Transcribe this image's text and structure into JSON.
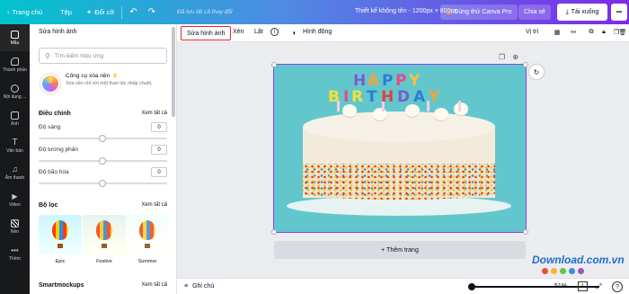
{
  "topbar": {
    "home": "Trang chủ",
    "file": "Tệp",
    "resize": "Đổi cỡ",
    "saved_note": "Đã lưu tất cả thay đổi",
    "design_title": "Thiết kế không tên - 1200px × 800px",
    "pro_button": "Dùng thử Canva Pro",
    "share_button": "Chia sẻ",
    "download_button": "Tải xuống",
    "more_button": "•••"
  },
  "rail": {
    "items": [
      {
        "label": "Mẫu",
        "icon": "template-icon"
      },
      {
        "label": "Thành phần",
        "icon": "elements-icon"
      },
      {
        "label": "Nội dung ...",
        "icon": "upload-icon"
      },
      {
        "label": "Ảnh",
        "icon": "photo-icon"
      },
      {
        "label": "Văn bản",
        "icon": "text-icon"
      },
      {
        "label": "Âm thanh",
        "icon": "audio-icon"
      },
      {
        "label": "Video",
        "icon": "video-icon"
      },
      {
        "label": "Nền",
        "icon": "background-icon"
      },
      {
        "label": "Thêm",
        "icon": "more-icon"
      }
    ]
  },
  "panel": {
    "title": "Sửa hình ảnh",
    "search_placeholder": "Tìm kiếm hiệu ứng",
    "bg_remover": {
      "name": "Công cụ xóa nền",
      "desc": "Xóa nền chỉ với một thao tác nhấp chuột."
    },
    "adjust": {
      "title": "Điều chỉnh",
      "see_all": "Xem tất cả",
      "sliders": [
        {
          "label": "Độ sáng",
          "value": "0"
        },
        {
          "label": "Độ tương phản",
          "value": "0"
        },
        {
          "label": "Độ bão hòa",
          "value": "0"
        }
      ]
    },
    "filters": {
      "title": "Bộ lọc",
      "see_all": "Xem tất cả",
      "items": [
        {
          "label": "Epic"
        },
        {
          "label": "Festive"
        },
        {
          "label": "Summer"
        }
      ]
    },
    "smartmockups": {
      "title": "Smartmockups",
      "see_all": "Xem tất cả"
    }
  },
  "context_toolbar": {
    "edit_image": "Sửa hình ảnh",
    "crop": "Xén",
    "flip": "Lật",
    "animate": "Hình động",
    "position": "Vị trí"
  },
  "canvas": {
    "cake_text": "HAPPY BIRTHDAY",
    "add_page": "+ Thêm trang"
  },
  "bottom": {
    "notes": "Ghi chú",
    "zoom": "51%",
    "page_number": "1",
    "help": "?"
  },
  "watermark": {
    "brand": "Download.com.vn"
  },
  "colors": {
    "accent_purple": "#8b3dff",
    "highlight_red": "#e3262c",
    "rail_bg": "#18191b"
  }
}
